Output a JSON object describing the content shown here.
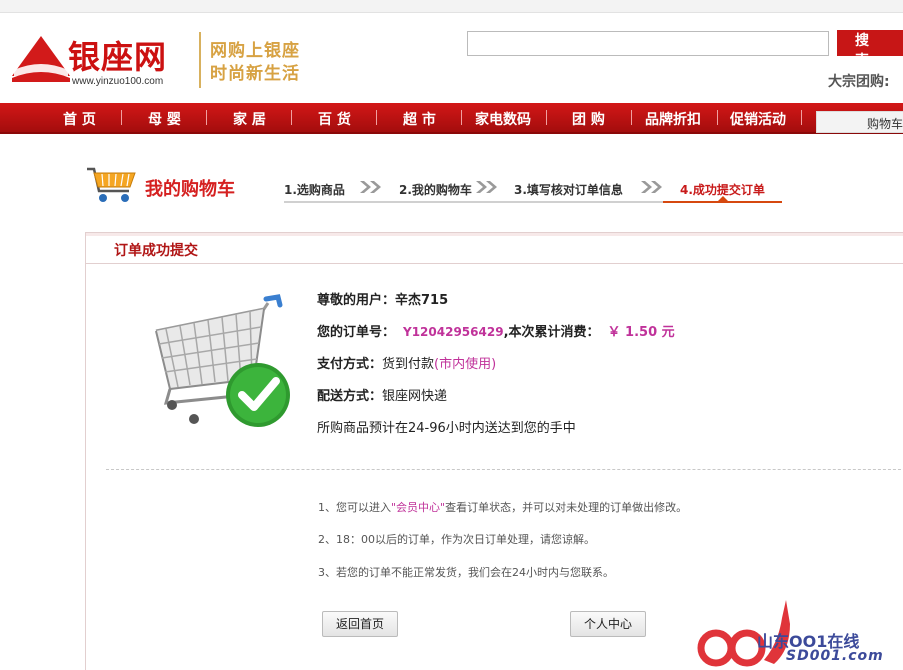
{
  "header": {
    "logo_text": "银座网",
    "logo_url": "www.yinzuo100.com",
    "slogan_line1": "网购上银座",
    "slogan_line2": "时尚新生活",
    "search_placeholder": "",
    "search_button": "搜 索",
    "group_buy": "大宗团购:"
  },
  "nav": {
    "items": [
      "首 页",
      "母 婴",
      "家 居",
      "百 货",
      "超 市",
      "家电数码",
      "团 购",
      "品牌折扣",
      "促销活动"
    ],
    "cart_label": "购物车"
  },
  "cart": {
    "title": "我的购物车",
    "steps": [
      "1.选购商品",
      "2.我的购物车",
      "3.填写核对订单信息",
      "4.成功提交订单"
    ],
    "active_step": 4
  },
  "panel": {
    "title": "订单成功提交",
    "user_label": "尊敬的用户：",
    "user_value": "辛杰715",
    "order_label": "您的订单号：",
    "order_no": "Y12042956429",
    "spend_label": ",本次累计消费：",
    "amount": "￥ 1.50 元",
    "pay_label": "支付方式：",
    "pay_value": "货到付款",
    "pay_note": "(市内使用)",
    "ship_label": "配送方式：",
    "ship_value": "银座网快递",
    "delivery_note": "所购商品预计在24-96小时内送达到您的手中"
  },
  "tips": {
    "tip1_before": "1、您可以进入",
    "tip1_link": "\"会员中心\"",
    "tip1_after": "查看订单状态，并可以对未处理的订单做出修改。",
    "tip2": "2、18：00以后的订单，作为次日订单处理，请您谅解。",
    "tip3": "3、若您的订单不能正常发货，我们会在24小时内与您联系。"
  },
  "buttons": {
    "back_home": "返回首页",
    "user_center": "个人中心"
  },
  "watermark": {
    "line1": "山东OO1在线",
    "line2": "SD001.com"
  },
  "colors": {
    "brand_red": "#c71616",
    "accent_magenta": "#c0329a",
    "slogan_gold": "#d7a243",
    "watermark_blue": "#3c4a9a"
  }
}
